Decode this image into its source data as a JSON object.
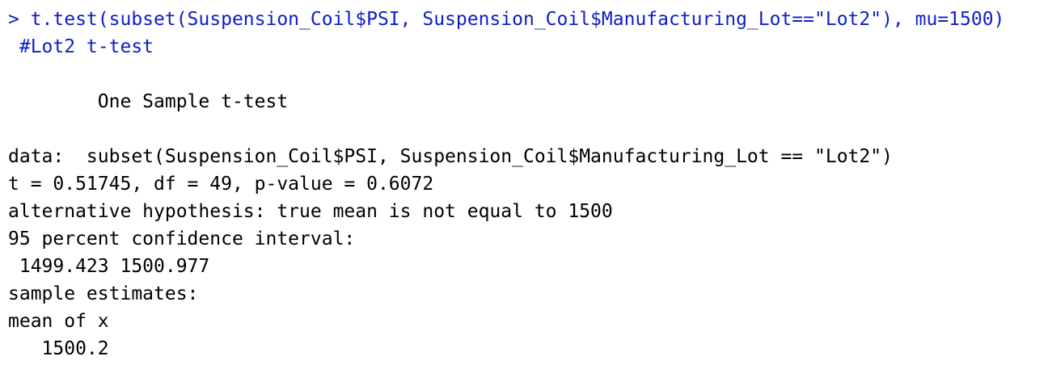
{
  "console": {
    "input": {
      "prompt_line": "> t.test(subset(Suspension_Coil$PSI, Suspension_Coil$Manufacturing_Lot==\"Lot2\"), mu=1500)",
      "comment_line": " #Lot2 t-test"
    },
    "output": {
      "test_title": "        One Sample t-test",
      "data_line": "data:  subset(Suspension_Coil$PSI, Suspension_Coil$Manufacturing_Lot == \"Lot2\")",
      "stat_line": "t = 0.51745, df = 49, p-value = 0.6072",
      "alternative_line": "alternative hypothesis: true mean is not equal to 1500",
      "ci_header": "95 percent confidence interval:",
      "ci_values": " 1499.423 1500.977",
      "estimates_header": "sample estimates:",
      "estimate_label": "mean of x",
      "estimate_value": "   1500.2"
    },
    "colors": {
      "input_text": "#0c1ec8",
      "output_text": "#000000",
      "background": "#ffffff"
    }
  }
}
